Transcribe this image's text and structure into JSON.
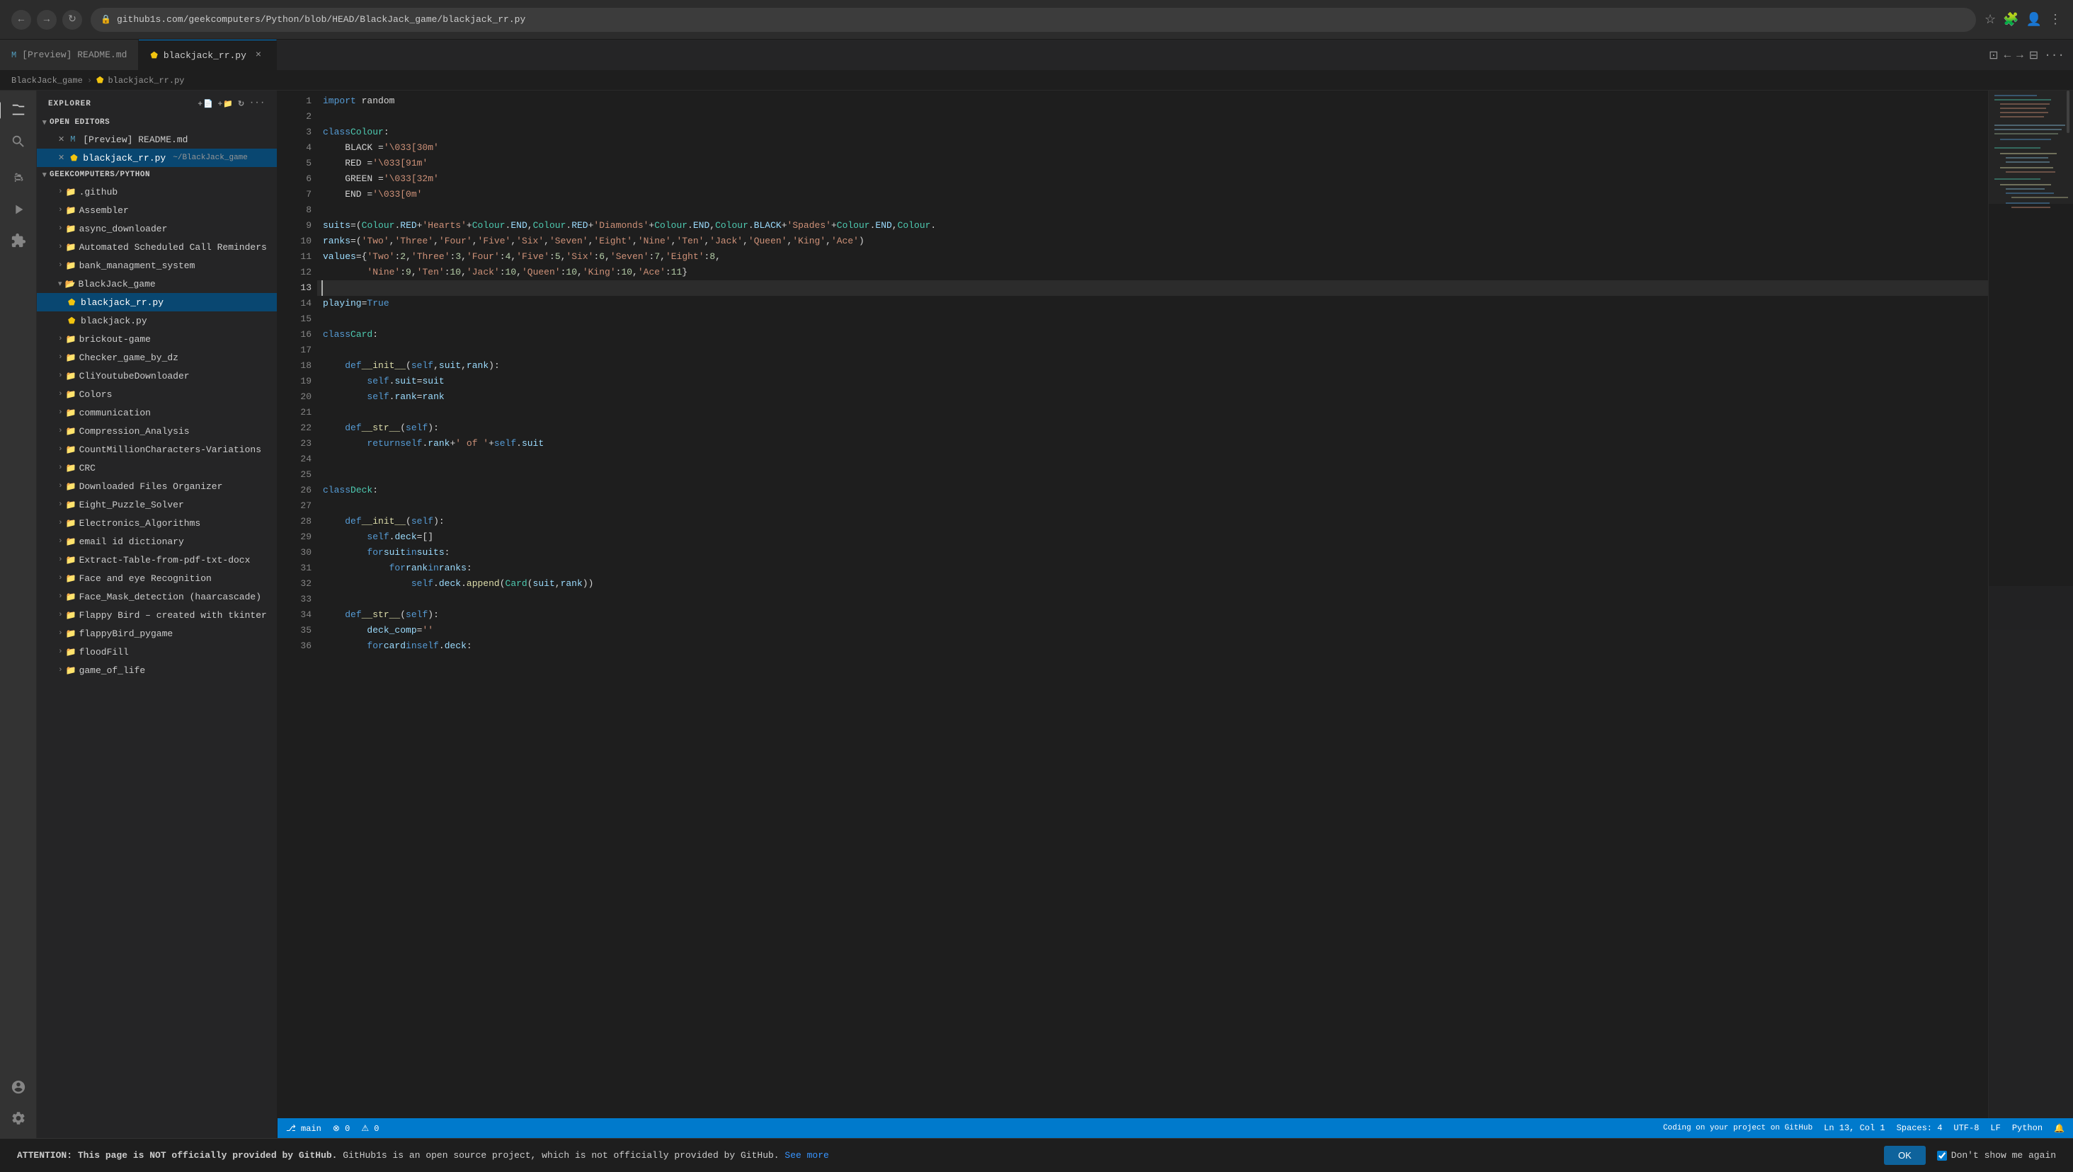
{
  "browser": {
    "url": "github1s.com/geekcomputers/Python/blob/HEAD/BlackJack_game/blackjack_rr.py",
    "back_label": "←",
    "forward_label": "→",
    "refresh_label": "↻"
  },
  "tabs": [
    {
      "label": "[Preview] README.md",
      "icon": "md",
      "active": false,
      "id": "tab-readme"
    },
    {
      "label": "blackjack_rr.py",
      "icon": "py",
      "active": true,
      "closeable": true,
      "id": "tab-blackjack"
    }
  ],
  "breadcrumb": {
    "parts": [
      "BlackJack_game",
      ">",
      "blackjack_rr.py"
    ]
  },
  "sidebar": {
    "title": "EXPLORER",
    "sections": {
      "open_editors": "OPEN EDITORS",
      "repo": "GEEKCOMPUTERS/PYTHON"
    },
    "open_files": [
      {
        "name": "[Preview] README.md",
        "icon": "md",
        "indent": 1
      },
      {
        "name": "blackjack_rr.py",
        "icon": "py",
        "indent": 1,
        "path": "~/BlackJack_game",
        "active": true
      }
    ],
    "tree": [
      {
        "name": ".github",
        "icon": "folder",
        "indent": 1,
        "expanded": false
      },
      {
        "name": "Assembler",
        "icon": "folder",
        "indent": 1,
        "expanded": false
      },
      {
        "name": "async_downloader",
        "icon": "folder",
        "indent": 1,
        "expanded": false
      },
      {
        "name": "Automated Scheduled Call Reminders",
        "icon": "folder",
        "indent": 1,
        "expanded": false
      },
      {
        "name": "bank_managment_system",
        "icon": "folder",
        "indent": 1,
        "expanded": false
      },
      {
        "name": "BlackJack_game",
        "icon": "folder-open",
        "indent": 1,
        "expanded": true
      },
      {
        "name": "blackjack_rr.py",
        "icon": "py",
        "indent": 2,
        "active": true
      },
      {
        "name": "blackjack.py",
        "icon": "py",
        "indent": 2
      },
      {
        "name": "brickout-game",
        "icon": "folder",
        "indent": 1,
        "expanded": false
      },
      {
        "name": "Checker_game_by_dz",
        "icon": "folder",
        "indent": 1,
        "expanded": false
      },
      {
        "name": "CliYoutubeDownloader",
        "icon": "folder",
        "indent": 1,
        "expanded": false
      },
      {
        "name": "Colors",
        "icon": "folder",
        "indent": 1,
        "expanded": false
      },
      {
        "name": "communication",
        "icon": "folder",
        "indent": 1,
        "expanded": false
      },
      {
        "name": "Compression_Analysis",
        "icon": "folder",
        "indent": 1,
        "expanded": false
      },
      {
        "name": "CountMillionCharacters-Variations",
        "icon": "folder",
        "indent": 1,
        "expanded": false
      },
      {
        "name": "CRC",
        "icon": "folder",
        "indent": 1,
        "expanded": false
      },
      {
        "name": "Downloaded Files Organizer",
        "icon": "folder",
        "indent": 1,
        "expanded": false
      },
      {
        "name": "Eight_Puzzle_Solver",
        "icon": "folder",
        "indent": 1,
        "expanded": false
      },
      {
        "name": "Electronics_Algorithms",
        "icon": "folder",
        "indent": 1,
        "expanded": false
      },
      {
        "name": "email id dictionary",
        "icon": "folder",
        "indent": 1,
        "expanded": false
      },
      {
        "name": "Extract-Table-from-pdf-txt-docx",
        "icon": "folder",
        "indent": 1,
        "expanded": false
      },
      {
        "name": "Face and eye Recognition",
        "icon": "folder",
        "indent": 1,
        "expanded": false
      },
      {
        "name": "Face_Mask_detection (haarcascade)",
        "icon": "folder",
        "indent": 1,
        "expanded": false
      },
      {
        "name": "Flappy Bird – created with tkinter",
        "icon": "folder",
        "indent": 1,
        "expanded": false
      },
      {
        "name": "flappyBird_pygame",
        "icon": "folder",
        "indent": 1,
        "expanded": false
      },
      {
        "name": "floodFill",
        "icon": "folder",
        "indent": 1,
        "expanded": false
      },
      {
        "name": "game_of_life",
        "icon": "folder",
        "indent": 1,
        "expanded": false
      }
    ]
  },
  "code": {
    "lines": [
      {
        "num": 1,
        "content": "import random"
      },
      {
        "num": 2,
        "content": ""
      },
      {
        "num": 3,
        "content": "class Colour:"
      },
      {
        "num": 4,
        "content": "    BLACK = '\\033[30m'"
      },
      {
        "num": 5,
        "content": "    RED = '\\033[91m'"
      },
      {
        "num": 6,
        "content": "    GREEN = '\\033[32m'"
      },
      {
        "num": 7,
        "content": "    END = '\\033[0m'"
      },
      {
        "num": 8,
        "content": ""
      },
      {
        "num": 9,
        "content": "suits = (Colour.RED + 'Hearts' + Colour.END, Colour.RED + 'Diamonds' + Colour.END, Colour.BLACK + 'Spades' + Colour.END, Colour."
      },
      {
        "num": 10,
        "content": "ranks = ('Two', 'Three', 'Four', 'Five', 'Six', 'Seven', 'Eight', 'Nine', 'Ten', 'Jack', 'Queen', 'King', 'Ace')"
      },
      {
        "num": 11,
        "content": "values = {'Two': 2, 'Three': 3, 'Four': 4, 'Five': 5, 'Six': 6, 'Seven': 7, 'Eight': 8,"
      },
      {
        "num": 12,
        "content": "        'Nine': 9, 'Ten': 10, 'Jack': 10, 'Queen': 10, 'King': 10, 'Ace': 11}"
      },
      {
        "num": 13,
        "content": ""
      },
      {
        "num": 14,
        "content": "playing = True"
      },
      {
        "num": 15,
        "content": ""
      },
      {
        "num": 16,
        "content": "class Card:"
      },
      {
        "num": 17,
        "content": ""
      },
      {
        "num": 18,
        "content": "    def __init__(self, suit, rank):"
      },
      {
        "num": 19,
        "content": "        self.suit = suit"
      },
      {
        "num": 20,
        "content": "        self.rank = rank"
      },
      {
        "num": 21,
        "content": ""
      },
      {
        "num": 22,
        "content": "    def __str__(self):"
      },
      {
        "num": 23,
        "content": "        return self.rank + ' of ' + self.suit"
      },
      {
        "num": 24,
        "content": ""
      },
      {
        "num": 25,
        "content": ""
      },
      {
        "num": 26,
        "content": "class Deck:"
      },
      {
        "num": 27,
        "content": ""
      },
      {
        "num": 28,
        "content": "    def __init__(self):"
      },
      {
        "num": 29,
        "content": "        self.deck = []"
      },
      {
        "num": 30,
        "content": "        for suit in suits:"
      },
      {
        "num": 31,
        "content": "            for rank in ranks:"
      },
      {
        "num": 32,
        "content": "                self.deck.append(Card(suit, rank))"
      },
      {
        "num": 33,
        "content": ""
      },
      {
        "num": 34,
        "content": "    def __str__(self):"
      },
      {
        "num": 35,
        "content": "        deck_comp = ''"
      },
      {
        "num": 36,
        "content": "        for card in self.deck:"
      }
    ]
  },
  "status_bar": {
    "left": [
      "⎇ main",
      "⚠ 0",
      "⊗ 0"
    ],
    "right": [
      "Ln 13, Col 1",
      "Spaces: 4",
      "UTF-8",
      "Python"
    ]
  },
  "notification": {
    "text": "ATTENTION: This page is NOT officially provided by GitHub.",
    "subtext": "GitHub1s is an open source project, which is not officially provided by GitHub.",
    "link_label": "See more",
    "ok_label": "OK",
    "dont_show_label": "Don't show me again",
    "checked": true
  }
}
